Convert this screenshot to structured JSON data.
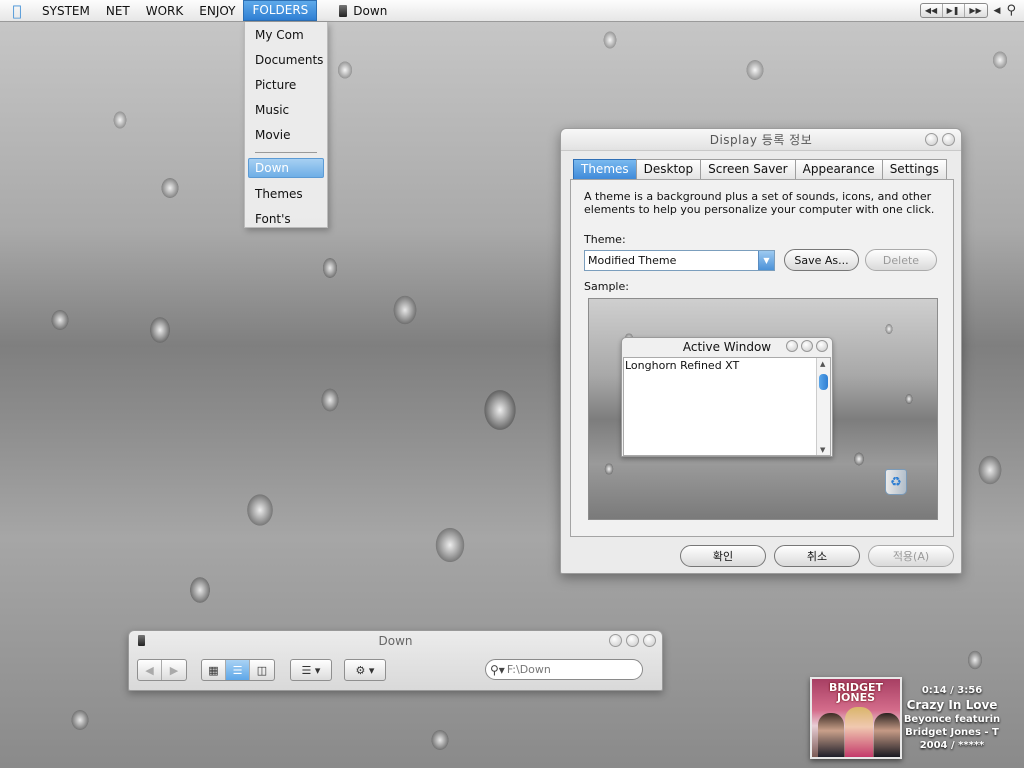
{
  "menubar": {
    "items": [
      {
        "label": "SYSTEM"
      },
      {
        "label": "NET"
      },
      {
        "label": "WORK"
      },
      {
        "label": "ENJOY"
      },
      {
        "label": "FOLDERS"
      }
    ],
    "current_folder": "Down"
  },
  "folders_menu": {
    "items": [
      {
        "label": "My Com"
      },
      {
        "label": "Documents"
      },
      {
        "label": "Picture"
      },
      {
        "label": "Music"
      },
      {
        "label": "Movie"
      }
    ],
    "items_after_separator": [
      {
        "label": "Down"
      },
      {
        "label": "Themes"
      },
      {
        "label": "Font's"
      }
    ],
    "selected": "Down"
  },
  "display_dialog": {
    "title": "Display 등록 정보",
    "tabs": [
      {
        "label": "Themes"
      },
      {
        "label": "Desktop"
      },
      {
        "label": "Screen Saver"
      },
      {
        "label": "Appearance"
      },
      {
        "label": "Settings"
      }
    ],
    "active_tab": "Themes",
    "description": "A theme is a background plus a set of sounds, icons, and other elements to help you personalize your computer with one click.",
    "theme_label": "Theme:",
    "theme_value": "Modified Theme",
    "save_as_label": "Save As...",
    "delete_label": "Delete",
    "sample_label": "Sample:",
    "sample_window": {
      "title": "Active Window",
      "body_text": "Longhorn Refined XT"
    },
    "ok_label": "확인",
    "cancel_label": "취소",
    "apply_label": "적용(A)"
  },
  "finder": {
    "title": "Down",
    "search_placeholder": "F:\\Down"
  },
  "now_playing": {
    "time": "0:14 / 3:56",
    "song": "Crazy In Love",
    "artist": "Beyonce featurin",
    "album": "Bridget Jones - T",
    "year_rating": "2004 / *****",
    "cover_text_line1": "BRIDGET",
    "cover_text_line2": "JONES"
  },
  "colors": {
    "accent": "#3f8ad9",
    "menubar_bg": "#f0f0f0",
    "dialog_bg": "#ebebeb"
  }
}
